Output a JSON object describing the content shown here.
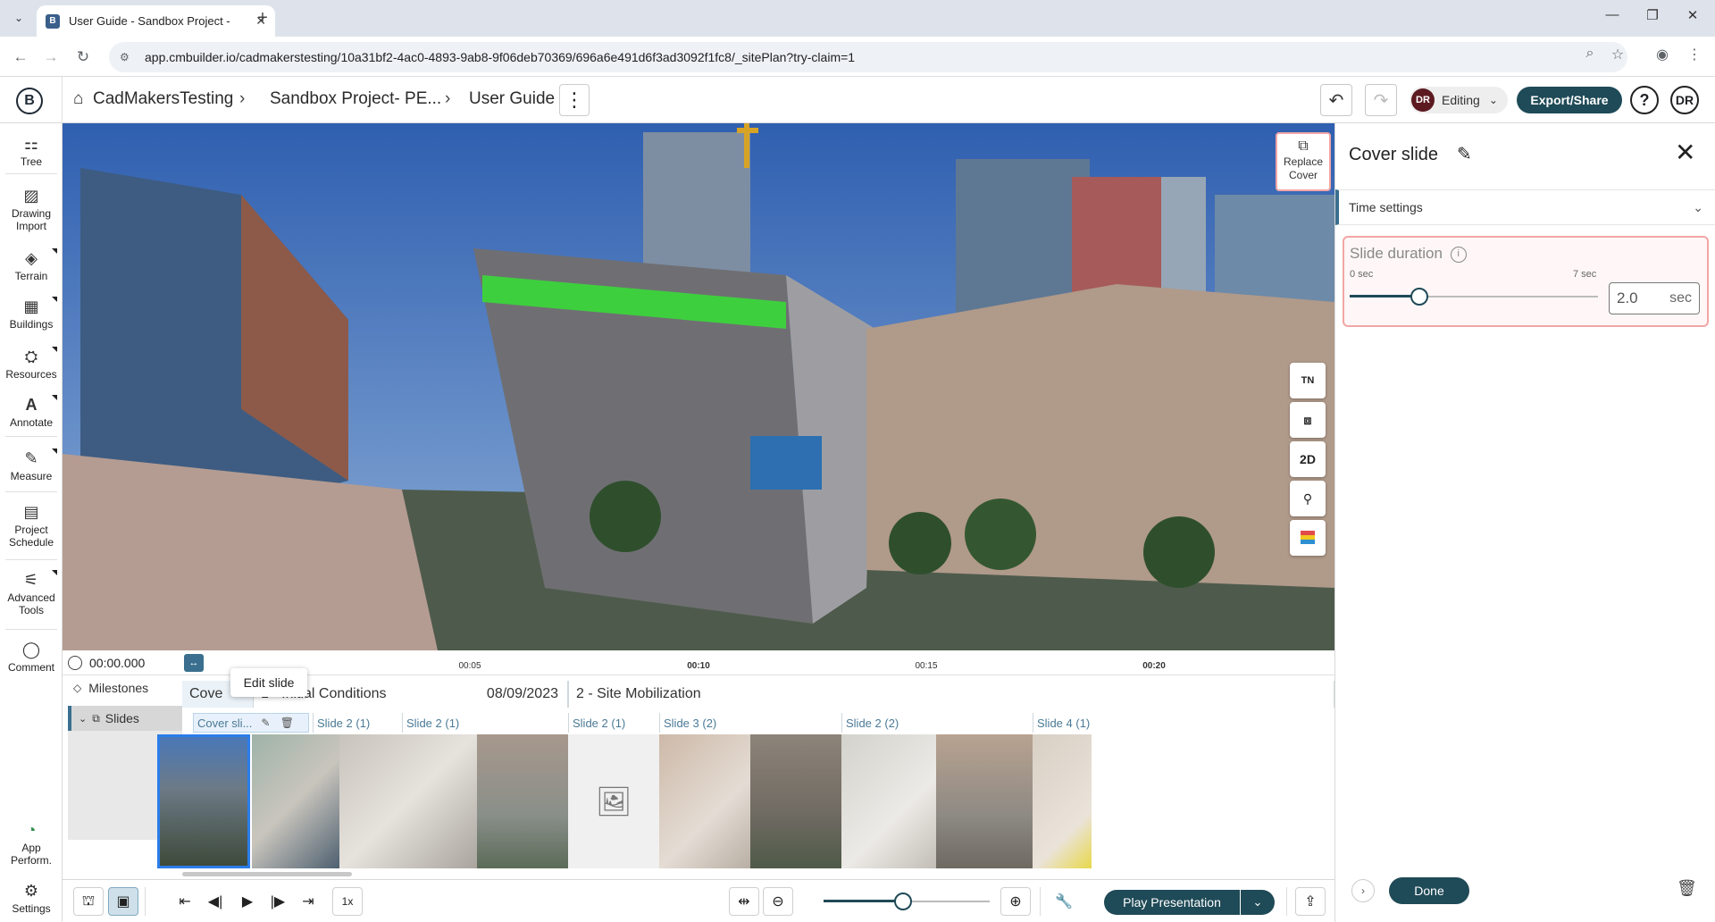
{
  "browser": {
    "tab_title": "User Guide - Sandbox Project -",
    "tab_favicon": "B",
    "url": "app.cmbuilder.io/cadmakerstesting/10a31bf2-4ac0-4893-9ab8-9f06deb70369/696a6e491d6f3ad3092f1fc8/_sitePlan?try-claim=1"
  },
  "header": {
    "logo": "B",
    "breadcrumb": [
      "CadMakersTesting",
      "Sandbox Project- PE...",
      "User Guide"
    ],
    "editing_avatar": "DR",
    "editing_label": "Editing",
    "export_label": "Export/Share",
    "help_label": "?",
    "user_avatar": "DR"
  },
  "left_tools": [
    {
      "label": "Tree",
      "icon": "tree-icon"
    },
    {
      "label": "Drawing Import",
      "icon": "drawing-import-icon"
    },
    {
      "label": "Terrain",
      "icon": "terrain-icon"
    },
    {
      "label": "Buildings",
      "icon": "buildings-icon"
    },
    {
      "label": "Resources",
      "icon": "resources-icon"
    },
    {
      "label": "Annotate",
      "icon": "annotate-icon"
    },
    {
      "label": "Measure",
      "icon": "measure-icon"
    },
    {
      "label": "Project Schedule",
      "icon": "schedule-icon"
    },
    {
      "label": "Advanced Tools",
      "icon": "advanced-tools-icon"
    },
    {
      "label": "Comment",
      "icon": "comment-icon"
    },
    {
      "label": "App Perform.",
      "icon": "app-performance-icon"
    },
    {
      "label": "Settings",
      "icon": "settings-icon"
    }
  ],
  "scene": {
    "replace_cover_label": "Replace Cover",
    "controls": [
      "TN",
      "layers",
      "2D",
      "person",
      "color"
    ]
  },
  "timeline": {
    "current_time": "00:00.000",
    "ticks": [
      {
        "label": "00:05",
        "bold": false
      },
      {
        "label": "00:10",
        "bold": true
      },
      {
        "label": "00:15",
        "bold": false
      },
      {
        "label": "00:20",
        "bold": true
      }
    ],
    "milestones_label": "Milestones",
    "slides_label": "Slides",
    "milestones": [
      {
        "title": "Cove",
        "date": ""
      },
      {
        "title": "1 - Initial Conditions",
        "date": "08/09/2023"
      },
      {
        "title": "2 - Site Mobilization",
        "date": ""
      }
    ],
    "slides": [
      {
        "label": "Cover sli..."
      },
      {
        "label": "Slide 2 (1)"
      },
      {
        "label": "Slide 2 (1)"
      },
      {
        "label": "Slide 2 (1)"
      },
      {
        "label": "Slide 3 (2)"
      },
      {
        "label": "Slide 2 (2)"
      },
      {
        "label": "Slide 4 (1)"
      }
    ],
    "tooltip": "Edit slide"
  },
  "bottombar": {
    "speed": "1x",
    "zoom_level": 0.48,
    "play_label": "Play Presentation"
  },
  "panel": {
    "title": "Cover slide",
    "section": "Time settings",
    "duration_label": "Slide duration",
    "min_label": "0 sec",
    "max_label": "7 sec",
    "duration_value": "2.0",
    "duration_unit": "sec",
    "duration_fraction": 0.28,
    "done_label": "Done"
  },
  "colors": {
    "brand": "#1f4a57",
    "accent_blue": "#3a6f8f",
    "highlight_red": "#f3a5a5",
    "sky": "#3f6fb8"
  }
}
